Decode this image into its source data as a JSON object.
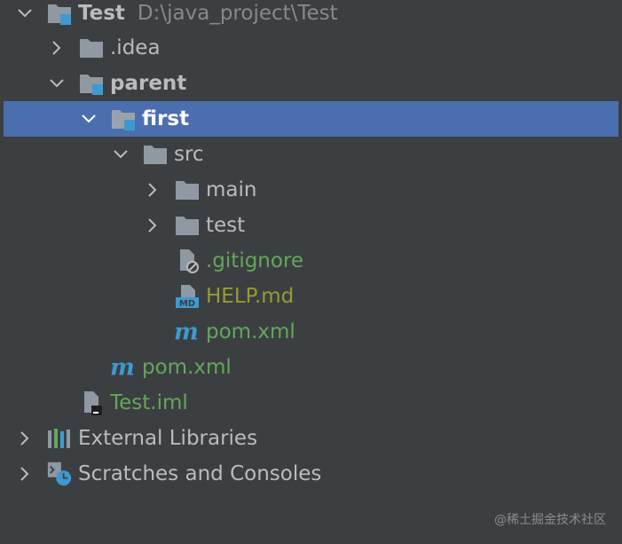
{
  "tree": {
    "root": {
      "label": "Test",
      "path": "D:\\java_project\\Test"
    },
    "idea": {
      "label": ".idea"
    },
    "parent": {
      "label": "parent"
    },
    "first": {
      "label": "first"
    },
    "src": {
      "label": "src"
    },
    "main": {
      "label": "main"
    },
    "test": {
      "label": "test"
    },
    "gitignore": {
      "label": ".gitignore"
    },
    "help": {
      "label": "HELP.md"
    },
    "pom_first": {
      "label": "pom.xml"
    },
    "pom_parent": {
      "label": "pom.xml"
    },
    "iml": {
      "label": "Test.iml"
    },
    "external": {
      "label": "External Libraries"
    },
    "scratches": {
      "label": "Scratches and Consoles"
    }
  },
  "watermark": "@稀土掘金技术社区",
  "colors": {
    "background": "#3c3f41",
    "selection": "#4b6eaf",
    "text": "#bbbbbb",
    "green_file": "#62a85a",
    "olive_file": "#9a9a2e",
    "folder": "#8f99a3",
    "module_badge": "#3d9ad1"
  }
}
